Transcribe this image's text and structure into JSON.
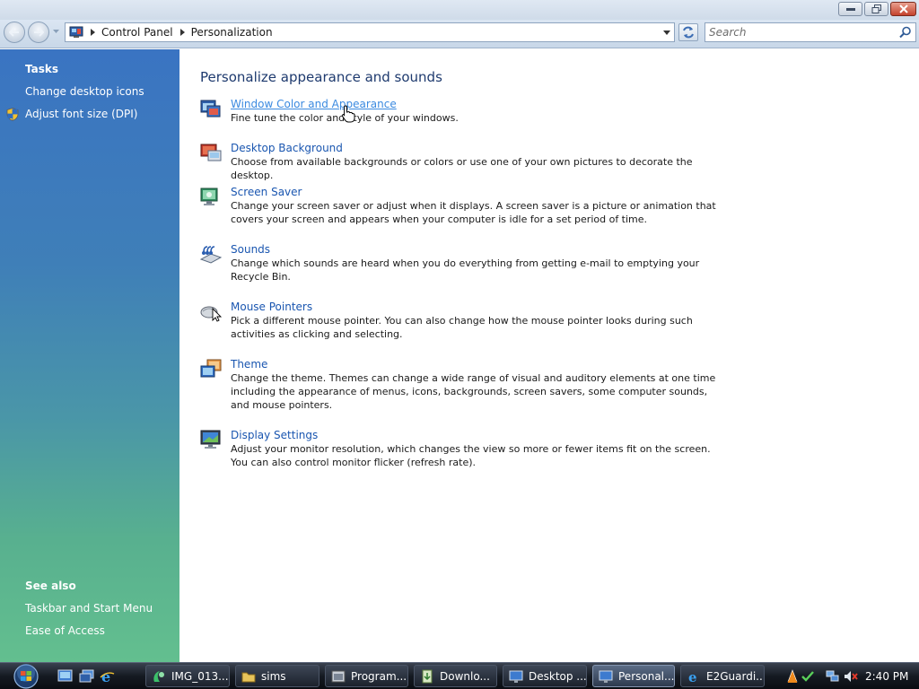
{
  "address": {
    "crumbs": [
      "Control Panel",
      "Personalization"
    ],
    "search_placeholder": "Search"
  },
  "sidebar": {
    "tasks_heading": "Tasks",
    "tasks": [
      "Change desktop icons",
      "Adjust font size (DPI)"
    ],
    "see_also_heading": "See also",
    "see_also": [
      "Taskbar and Start Menu",
      "Ease of Access"
    ]
  },
  "main": {
    "heading": "Personalize appearance and sounds",
    "items": [
      {
        "title": "Window Color and Appearance",
        "desc": "Fine tune the color and style of your windows.",
        "icon": "window-color-icon"
      },
      {
        "title": "Desktop Background",
        "desc": "Choose from available backgrounds or colors or use one of your own pictures to decorate the desktop.",
        "icon": "desktop-background-icon"
      },
      {
        "title": "Screen Saver",
        "desc": "Change your screen saver or adjust when it displays. A screen saver is a picture or animation that covers your screen and appears when your computer is idle for a set period of time.",
        "icon": "screen-saver-icon"
      },
      {
        "title": "Sounds",
        "desc": "Change which sounds are heard when you do everything from getting e-mail to emptying your Recycle Bin.",
        "icon": "sounds-icon"
      },
      {
        "title": "Mouse Pointers",
        "desc": "Pick a different mouse pointer. You can also change how the mouse pointer looks during such activities as clicking and selecting.",
        "icon": "mouse-pointers-icon"
      },
      {
        "title": "Theme",
        "desc": "Change the theme. Themes can change a wide range of visual and auditory elements at one time including the appearance of menus, icons, backgrounds, screen savers, some computer sounds, and mouse pointers.",
        "icon": "theme-icon"
      },
      {
        "title": "Display Settings",
        "desc": "Adjust your monitor resolution, which changes the view so more or fewer items fit on the screen. You can also control monitor flicker (refresh rate).",
        "icon": "display-settings-icon"
      }
    ]
  },
  "taskbar": {
    "buttons": [
      {
        "label": "IMG_013...",
        "active": false
      },
      {
        "label": "sims",
        "active": false
      },
      {
        "label": "Program...",
        "active": false
      },
      {
        "label": "Downlo...",
        "active": false
      },
      {
        "label": "Desktop ...",
        "active": false
      },
      {
        "label": "Personal...",
        "active": true
      },
      {
        "label": "E2Guardi...",
        "active": false
      }
    ],
    "clock": "2:40 PM"
  },
  "colors": {
    "link": "#1a56b0",
    "heading": "#1e3a6e",
    "sidebar_top": "#3a74c2",
    "sidebar_bottom": "#63bf8f"
  }
}
